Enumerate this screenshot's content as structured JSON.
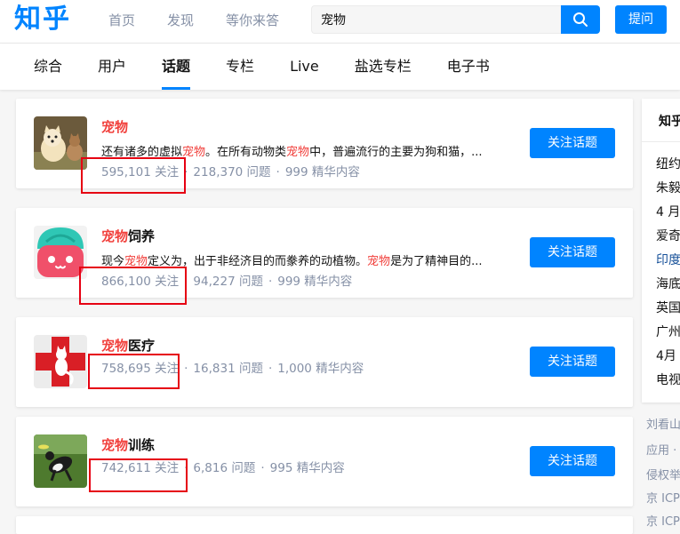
{
  "header": {
    "logo": "知乎",
    "nav": [
      "首页",
      "发现",
      "等你来答"
    ],
    "search_value": "宠物",
    "ask_label": "提问"
  },
  "tabs": [
    "综合",
    "用户",
    "话题",
    "专栏",
    "Live",
    "盐选专栏",
    "电子书"
  ],
  "active_tab": "话题",
  "topics": [
    {
      "title_em": "宠物",
      "title_rest": "",
      "excerpt": [
        {
          "t": "还有诸多的虚拟",
          "em": false
        },
        {
          "t": "宠物",
          "em": true
        },
        {
          "t": "。在所有动物类",
          "em": false
        },
        {
          "t": "宠物",
          "em": true
        },
        {
          "t": "中，普遍流行的主要为狗和猫，...",
          "em": false
        }
      ],
      "followers": "595,101 关注",
      "questions": "218,370 问题",
      "featured": "999 精华内容",
      "button": "关注话题"
    },
    {
      "title_em": "宠物",
      "title_rest": "饲养",
      "excerpt": [
        {
          "t": "现今",
          "em": false
        },
        {
          "t": "宠物",
          "em": true
        },
        {
          "t": "定义为，出于非经济目的而豢养的动植物。",
          "em": false
        },
        {
          "t": "宠物",
          "em": true
        },
        {
          "t": "是为了精神目的...",
          "em": false
        }
      ],
      "followers": "866,100 关注",
      "questions": "94,227 问题",
      "featured": "999 精华内容",
      "button": "关注话题"
    },
    {
      "title_em": "宠物",
      "title_rest": "医疗",
      "excerpt": [],
      "followers": "758,695 关注",
      "questions": "16,831 问题",
      "featured": "1,000 精华内容",
      "button": "关注话题"
    },
    {
      "title_em": "宠物",
      "title_rest": "训练",
      "excerpt": [],
      "followers": "742,611 关注",
      "questions": "6,816 问题",
      "featured": "995 精华内容",
      "button": "关注话题"
    }
  ],
  "sidebar": {
    "title": "知乎",
    "items": [
      "纽约",
      "朱毅",
      "4 月",
      "爱奇",
      "印度",
      "海底",
      "英国",
      "广州",
      "4月",
      "电视"
    ],
    "link_index": 4
  },
  "footer": [
    "刘看山",
    "应用 ·",
    "侵权举",
    "京 ICP",
    "京 ICP"
  ],
  "colors": {
    "brand": "#0084ff",
    "highlight": "#f1403c",
    "annotation": "#e60012",
    "muted": "#8590a6"
  }
}
